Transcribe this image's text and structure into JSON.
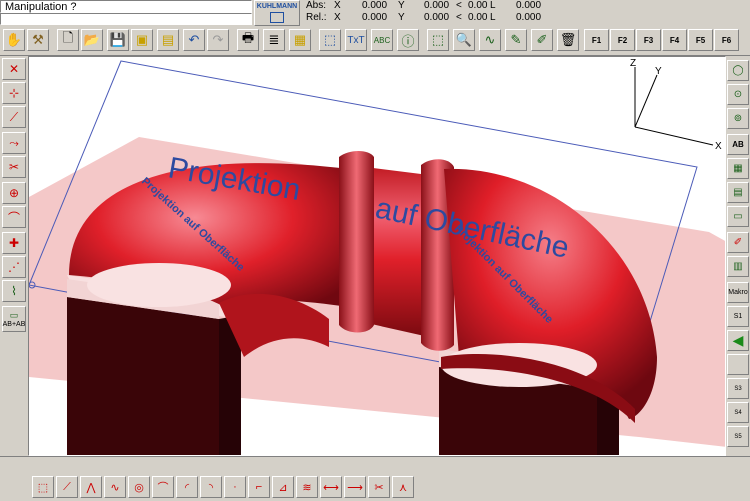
{
  "status": {
    "prompt": "Manipulation ?",
    "logo_text": "KUHLMANN"
  },
  "coords": {
    "abs_label": "Abs:",
    "rel_label": "Rel.:",
    "x_label": "X",
    "y_label": "Y",
    "angle_label": "<",
    "l_label": "L",
    "abs_x": "0.000",
    "abs_y": "0.000",
    "abs_angle": "0.00",
    "abs_l": "0.000",
    "rel_x": "0.000",
    "rel_y": "0.000",
    "rel_angle": "0.00",
    "rel_l": "0.000"
  },
  "fkeys": [
    "F1",
    "F2",
    "F3",
    "F4",
    "F5",
    "F6"
  ],
  "viewport": {
    "axis_z": "Z",
    "axis_y": "Y",
    "axis_x": "X",
    "text_main1": "Projektion",
    "text_main2": "auf Oberfläche",
    "text_small": "Projektion auf Oberfläche"
  },
  "right_labels": {
    "makro": "Makro",
    "s3": "S3",
    "s4": "S4",
    "s5": "S5",
    "s1": "S1"
  },
  "left_labels": {
    "ab_ab": "AB+AB"
  },
  "colors": {
    "ui_bg": "#d4d0c8",
    "model_red": "#e0202a",
    "plane_pink": "#f4c8c8",
    "text_blue": "#2d4aa0",
    "text_green": "#3a9a3a"
  }
}
